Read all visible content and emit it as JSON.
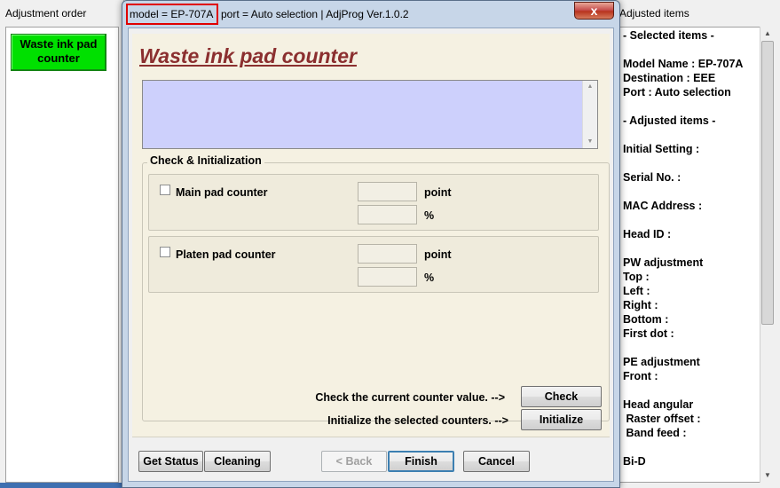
{
  "left_window": {
    "title": "Adjustment order",
    "order_item": "Waste ink pad counter"
  },
  "right_window": {
    "title": "Adjusted items",
    "items": [
      "- Selected items -",
      "",
      "Model Name : EP-707A",
      "Destination : EEE",
      "Port : Auto selection",
      "",
      "- Adjusted items -",
      "",
      "Initial Setting :",
      "",
      "Serial No. :",
      "",
      "MAC Address :",
      "",
      "Head ID :",
      "",
      "PW adjustment",
      "Top :",
      "Left :",
      "Right :",
      "Bottom :",
      "First dot :",
      "",
      "PE adjustment",
      "Front :",
      "",
      "Head angular",
      " Raster offset :",
      " Band feed :",
      "",
      "Bi-D"
    ]
  },
  "dialog": {
    "title_model": "model = EP-707A",
    "title_rest": "port = Auto selection | AdjProg Ver.1.0.2",
    "close_glyph": "x",
    "heading": "Waste ink pad counter",
    "group_label": "Check & Initialization",
    "main_pad": {
      "label": "Main pad counter",
      "unit_point": "point",
      "unit_percent": "%",
      "checked": false
    },
    "platen_pad": {
      "label": "Platen pad counter",
      "unit_point": "point",
      "unit_percent": "%",
      "checked": false
    },
    "check_hint": "Check the current counter value.  -->",
    "check_button": "Check",
    "init_hint": "Initialize the selected counters.  -->",
    "init_button": "Initialize",
    "footer": {
      "get_status": "Get Status",
      "cleaning": "Cleaning",
      "back": "< Back",
      "finish": "Finish",
      "cancel": "Cancel"
    }
  },
  "colors": {
    "accent_highlight": "#e00000",
    "heading": "#8b2f2f",
    "order_button": "#00e000",
    "log_box": "#cdd0fc",
    "panel": "#f5f1e2"
  }
}
